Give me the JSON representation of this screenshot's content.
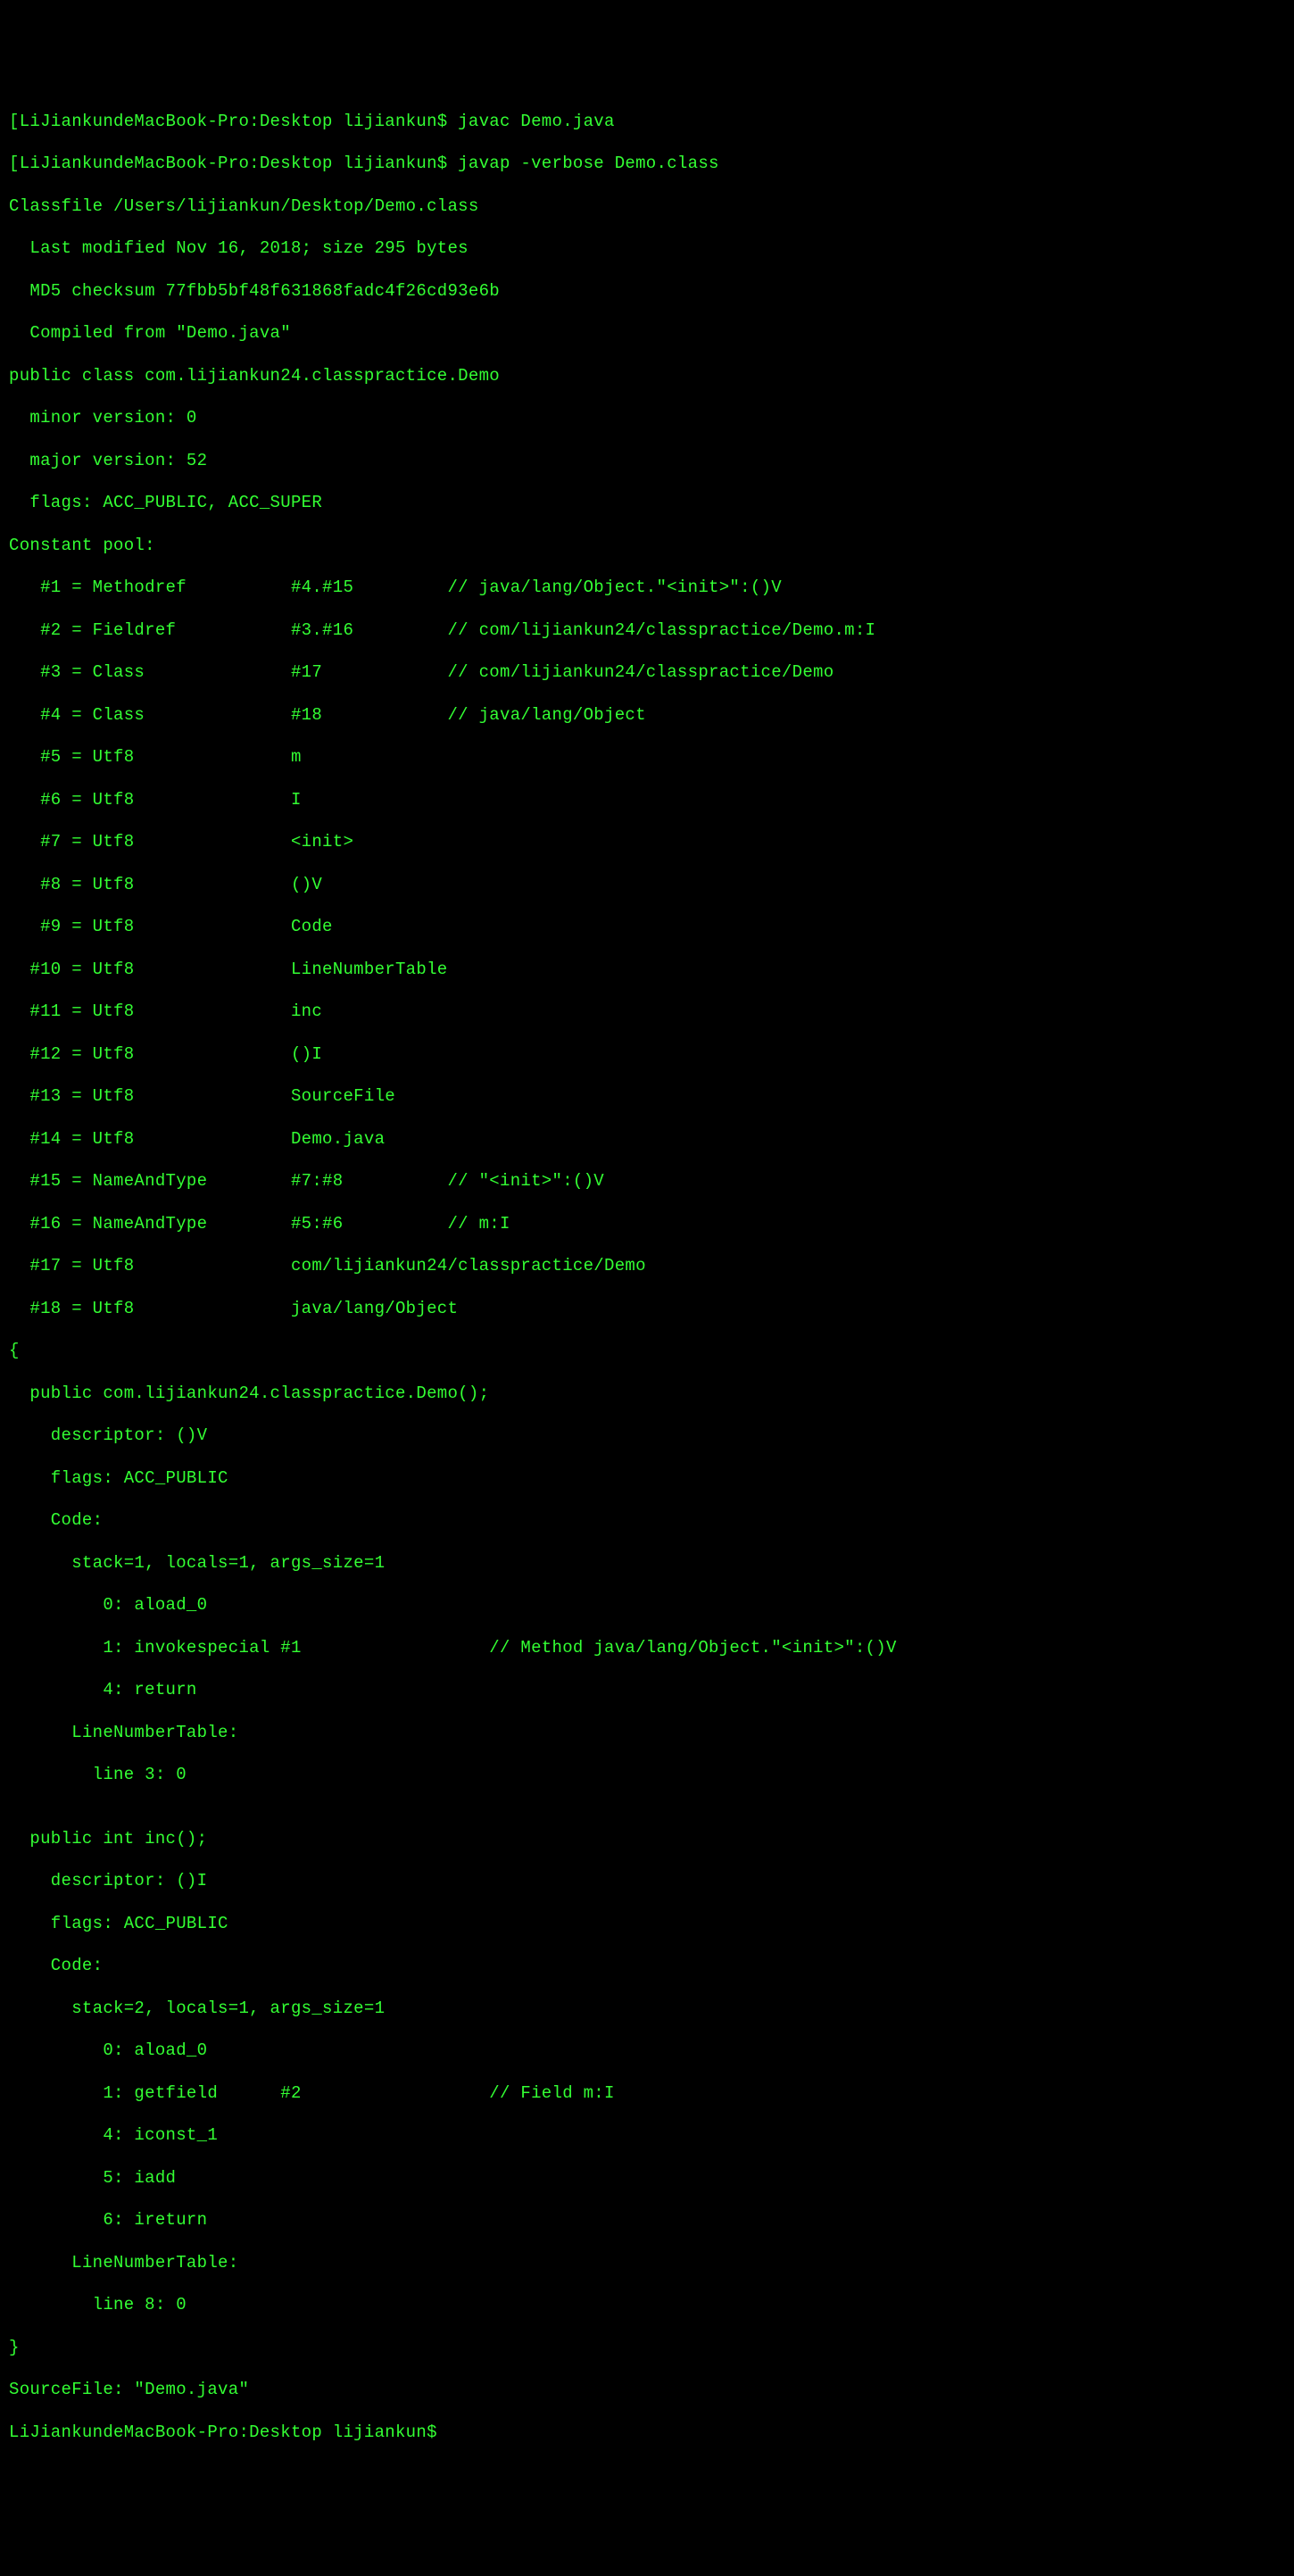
{
  "prompt1": "[LiJiankundeMacBook-Pro:Desktop lijiankun$ javac Demo.java",
  "prompt2": "[LiJiankundeMacBook-Pro:Desktop lijiankun$ javap -verbose Demo.class",
  "classfile": "Classfile /Users/lijiankun/Desktop/Demo.class",
  "lastmod": "  Last modified Nov 16, 2018; size 295 bytes",
  "md5": "  MD5 checksum 77fbb5bf48f631868fadc4f26cd93e6b",
  "compiled": "  Compiled from \"Demo.java\"",
  "classdecl": "public class com.lijiankun24.classpractice.Demo",
  "minor": "  minor version: 0",
  "major": "  major version: 52",
  "flags": "  flags: ACC_PUBLIC, ACC_SUPER",
  "cpheader": "Constant pool:",
  "cp1": "   #1 = Methodref          #4.#15         // java/lang/Object.\"<init>\":()V",
  "cp2": "   #2 = Fieldref           #3.#16         // com/lijiankun24/classpractice/Demo.m:I",
  "cp3": "   #3 = Class              #17            // com/lijiankun24/classpractice/Demo",
  "cp4": "   #4 = Class              #18            // java/lang/Object",
  "cp5": "   #5 = Utf8               m",
  "cp6": "   #6 = Utf8               I",
  "cp7": "   #7 = Utf8               <init>",
  "cp8": "   #8 = Utf8               ()V",
  "cp9": "   #9 = Utf8               Code",
  "cp10": "  #10 = Utf8               LineNumberTable",
  "cp11": "  #11 = Utf8               inc",
  "cp12": "  #12 = Utf8               ()I",
  "cp13": "  #13 = Utf8               SourceFile",
  "cp14": "  #14 = Utf8               Demo.java",
  "cp15": "  #15 = NameAndType        #7:#8          // \"<init>\":()V",
  "cp16": "  #16 = NameAndType        #5:#6          // m:I",
  "cp17": "  #17 = Utf8               com/lijiankun24/classpractice/Demo",
  "cp18": "  #18 = Utf8               java/lang/Object",
  "brace_open": "{",
  "ctor_sig": "  public com.lijiankun24.classpractice.Demo();",
  "ctor_desc": "    descriptor: ()V",
  "ctor_flags": "    flags: ACC_PUBLIC",
  "ctor_code": "    Code:",
  "ctor_stack": "      stack=1, locals=1, args_size=1",
  "ctor_i0": "         0: aload_0",
  "ctor_i1": "         1: invokespecial #1                  // Method java/lang/Object.\"<init>\":()V",
  "ctor_i4": "         4: return",
  "ctor_lnt": "      LineNumberTable:",
  "ctor_lnt0": "        line 3: 0",
  "blank": "",
  "inc_sig": "  public int inc();",
  "inc_desc": "    descriptor: ()I",
  "inc_flags": "    flags: ACC_PUBLIC",
  "inc_code": "    Code:",
  "inc_stack": "      stack=2, locals=1, args_size=1",
  "inc_i0": "         0: aload_0",
  "inc_i1": "         1: getfield      #2                  // Field m:I",
  "inc_i4": "         4: iconst_1",
  "inc_i5": "         5: iadd",
  "inc_i6": "         6: ireturn",
  "inc_lnt": "      LineNumberTable:",
  "inc_lnt0": "        line 8: 0",
  "brace_close": "}",
  "sourcefile": "SourceFile: \"Demo.java\"",
  "prompt3": "LiJiankundeMacBook-Pro:Desktop lijiankun$"
}
